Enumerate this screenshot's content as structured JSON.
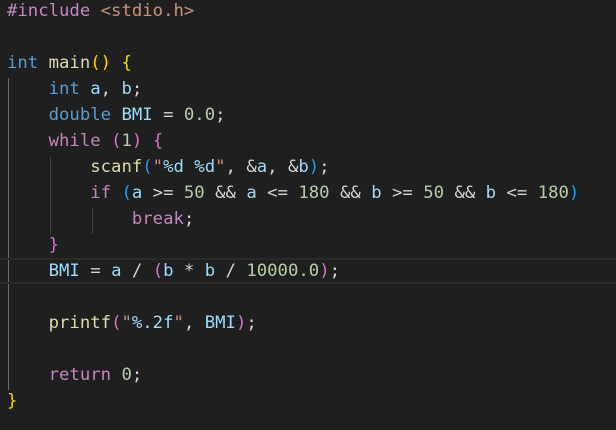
{
  "editor": {
    "language": "C",
    "theme": "dark",
    "colors": {
      "background": "#1f1f1f",
      "keyword_type": "#569cd6",
      "keyword_control": "#c586c0",
      "function": "#dcdcaa",
      "variable": "#9cdcfe",
      "number": "#b5cea8",
      "string": "#ce9178",
      "bracket_level_1": "#ffd700",
      "bracket_level_2": "#da70d6",
      "bracket_level_3": "#179fff"
    },
    "lines": [
      [
        {
          "t": "#include ",
          "k": "pre"
        },
        {
          "t": "<stdio.h>",
          "k": "inc"
        }
      ],
      [],
      [
        {
          "t": "int",
          "k": "type"
        },
        {
          "t": " ",
          "k": "pun"
        },
        {
          "t": "main",
          "k": "fn"
        },
        {
          "t": "()",
          "k": "br1"
        },
        {
          "t": " ",
          "k": "pun"
        },
        {
          "t": "{",
          "k": "br1"
        }
      ],
      [
        {
          "t": "    ",
          "k": "pun"
        },
        {
          "t": "int",
          "k": "type"
        },
        {
          "t": " ",
          "k": "pun"
        },
        {
          "t": "a",
          "k": "var"
        },
        {
          "t": ", ",
          "k": "pun"
        },
        {
          "t": "b",
          "k": "var"
        },
        {
          "t": ";",
          "k": "pun"
        }
      ],
      [
        {
          "t": "    ",
          "k": "pun"
        },
        {
          "t": "double",
          "k": "type"
        },
        {
          "t": " ",
          "k": "pun"
        },
        {
          "t": "BMI",
          "k": "var"
        },
        {
          "t": " = ",
          "k": "op"
        },
        {
          "t": "0.0",
          "k": "num"
        },
        {
          "t": ";",
          "k": "pun"
        }
      ],
      [
        {
          "t": "    ",
          "k": "pun"
        },
        {
          "t": "while",
          "k": "ctl"
        },
        {
          "t": " ",
          "k": "pun"
        },
        {
          "t": "(",
          "k": "br2"
        },
        {
          "t": "1",
          "k": "num"
        },
        {
          "t": ")",
          "k": "br2"
        },
        {
          "t": " ",
          "k": "pun"
        },
        {
          "t": "{",
          "k": "br2"
        }
      ],
      [
        {
          "t": "        ",
          "k": "pun"
        },
        {
          "t": "scanf",
          "k": "fn"
        },
        {
          "t": "(",
          "k": "br3"
        },
        {
          "t": "\"",
          "k": "str"
        },
        {
          "t": "%d",
          "k": "fmt"
        },
        {
          "t": " ",
          "k": "str"
        },
        {
          "t": "%d",
          "k": "fmt"
        },
        {
          "t": "\"",
          "k": "str"
        },
        {
          "t": ", ",
          "k": "pun"
        },
        {
          "t": "&",
          "k": "op"
        },
        {
          "t": "a",
          "k": "var"
        },
        {
          "t": ", ",
          "k": "pun"
        },
        {
          "t": "&",
          "k": "op"
        },
        {
          "t": "b",
          "k": "var"
        },
        {
          "t": ")",
          "k": "br3"
        },
        {
          "t": ";",
          "k": "pun"
        }
      ],
      [
        {
          "t": "        ",
          "k": "pun"
        },
        {
          "t": "if",
          "k": "ctl"
        },
        {
          "t": " ",
          "k": "pun"
        },
        {
          "t": "(",
          "k": "br3"
        },
        {
          "t": "a",
          "k": "var"
        },
        {
          "t": " >= ",
          "k": "op"
        },
        {
          "t": "50",
          "k": "num"
        },
        {
          "t": " && ",
          "k": "op"
        },
        {
          "t": "a",
          "k": "var"
        },
        {
          "t": " <= ",
          "k": "op"
        },
        {
          "t": "180",
          "k": "num"
        },
        {
          "t": " && ",
          "k": "op"
        },
        {
          "t": "b",
          "k": "var"
        },
        {
          "t": " >= ",
          "k": "op"
        },
        {
          "t": "50",
          "k": "num"
        },
        {
          "t": " && ",
          "k": "op"
        },
        {
          "t": "b",
          "k": "var"
        },
        {
          "t": " <= ",
          "k": "op"
        },
        {
          "t": "180",
          "k": "num"
        },
        {
          "t": ")",
          "k": "br3"
        }
      ],
      [
        {
          "t": "            ",
          "k": "pun"
        },
        {
          "t": "break",
          "k": "ctl"
        },
        {
          "t": ";",
          "k": "pun"
        }
      ],
      [
        {
          "t": "    ",
          "k": "pun"
        },
        {
          "t": "}",
          "k": "br2"
        }
      ],
      [
        {
          "t": "    ",
          "k": "pun"
        },
        {
          "t": "BMI",
          "k": "var"
        },
        {
          "t": " = ",
          "k": "op"
        },
        {
          "t": "a",
          "k": "var"
        },
        {
          "t": " / ",
          "k": "op"
        },
        {
          "t": "(",
          "k": "br2"
        },
        {
          "t": "b",
          "k": "var"
        },
        {
          "t": " * ",
          "k": "op"
        },
        {
          "t": "b",
          "k": "var"
        },
        {
          "t": " / ",
          "k": "op"
        },
        {
          "t": "10000.0",
          "k": "num"
        },
        {
          "t": ")",
          "k": "br2"
        },
        {
          "t": ";",
          "k": "pun"
        }
      ],
      [],
      [
        {
          "t": "    ",
          "k": "pun"
        },
        {
          "t": "printf",
          "k": "fn"
        },
        {
          "t": "(",
          "k": "br2"
        },
        {
          "t": "\"",
          "k": "str"
        },
        {
          "t": "%.2f",
          "k": "fmt"
        },
        {
          "t": "\"",
          "k": "str"
        },
        {
          "t": ", ",
          "k": "pun"
        },
        {
          "t": "BMI",
          "k": "var"
        },
        {
          "t": ")",
          "k": "br2"
        },
        {
          "t": ";",
          "k": "pun"
        }
      ],
      [],
      [
        {
          "t": "    ",
          "k": "pun"
        },
        {
          "t": "return",
          "k": "ctl"
        },
        {
          "t": " ",
          "k": "pun"
        },
        {
          "t": "0",
          "k": "num"
        },
        {
          "t": ";",
          "k": "pun"
        }
      ],
      [
        {
          "t": "}",
          "k": "br1"
        }
      ]
    ]
  }
}
